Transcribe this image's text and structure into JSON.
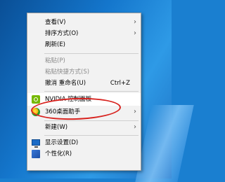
{
  "menu": {
    "items": [
      {
        "label": "查看(V)",
        "arrow": "›"
      },
      {
        "label": "排序方式(O)",
        "arrow": "›"
      },
      {
        "label": "刷新(E)"
      },
      {
        "label": "粘贴(P)"
      },
      {
        "label": "粘贴快捷方式(S)"
      },
      {
        "label": "撤消 重命名(U)",
        "shortcut": "Ctrl+Z"
      },
      {
        "label": "NVIDIA 控制面板",
        "icon": "nvidia-icon"
      },
      {
        "label": "360桌面助手",
        "arrow": "›",
        "icon": "360-icon"
      },
      {
        "label": "新建(W)",
        "arrow": "›"
      },
      {
        "label": "显示设置(D)",
        "icon": "display-icon"
      },
      {
        "label": "个性化(R)",
        "icon": "personalize-icon"
      }
    ]
  },
  "colors": {
    "highlight_circle": "#d8231f",
    "nvidia_green": "#76b900"
  }
}
